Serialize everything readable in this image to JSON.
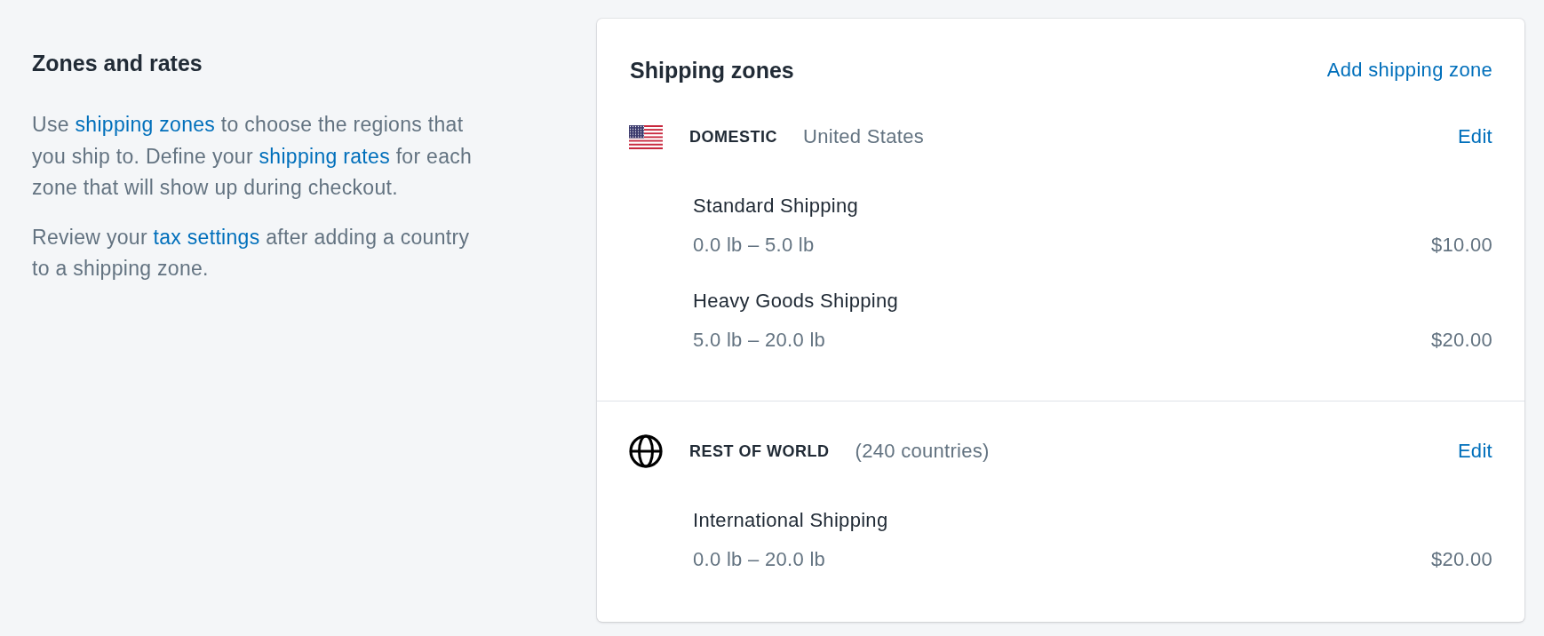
{
  "section": {
    "title": "Zones and rates",
    "paragraphs": [
      [
        {
          "kind": "text",
          "text": "Use "
        },
        {
          "kind": "link",
          "text": "shipping zones"
        },
        {
          "kind": "text",
          "text": " to choose the regions that you ship to. Define your "
        },
        {
          "kind": "link",
          "text": "shipping rates"
        },
        {
          "kind": "text",
          "text": " for each zone that will show up during checkout."
        }
      ],
      [
        {
          "kind": "text",
          "text": "Review your "
        },
        {
          "kind": "link",
          "text": "tax settings"
        },
        {
          "kind": "text",
          "text": " after adding a country to a shipping zone."
        }
      ]
    ]
  },
  "card": {
    "title": "Shipping zones",
    "action": "Add shipping zone",
    "zones": [
      {
        "kind": "country",
        "name": "DOMESTIC",
        "detail": "United States",
        "action": "Edit",
        "rates": [
          {
            "name": "Standard Shipping",
            "range": "0.0 lb – 5.0 lb",
            "price": "$10.00"
          },
          {
            "name": "Heavy Goods Shipping",
            "range": "5.0 lb – 20.0 lb",
            "price": "$20.00"
          }
        ]
      },
      {
        "kind": "world",
        "name": "REST OF WORLD",
        "detail": "(240 countries)",
        "action": "Edit",
        "rates": [
          {
            "name": "International Shipping",
            "range": "0.0 lb – 20.0 lb",
            "price": "$20.00"
          }
        ]
      }
    ]
  }
}
